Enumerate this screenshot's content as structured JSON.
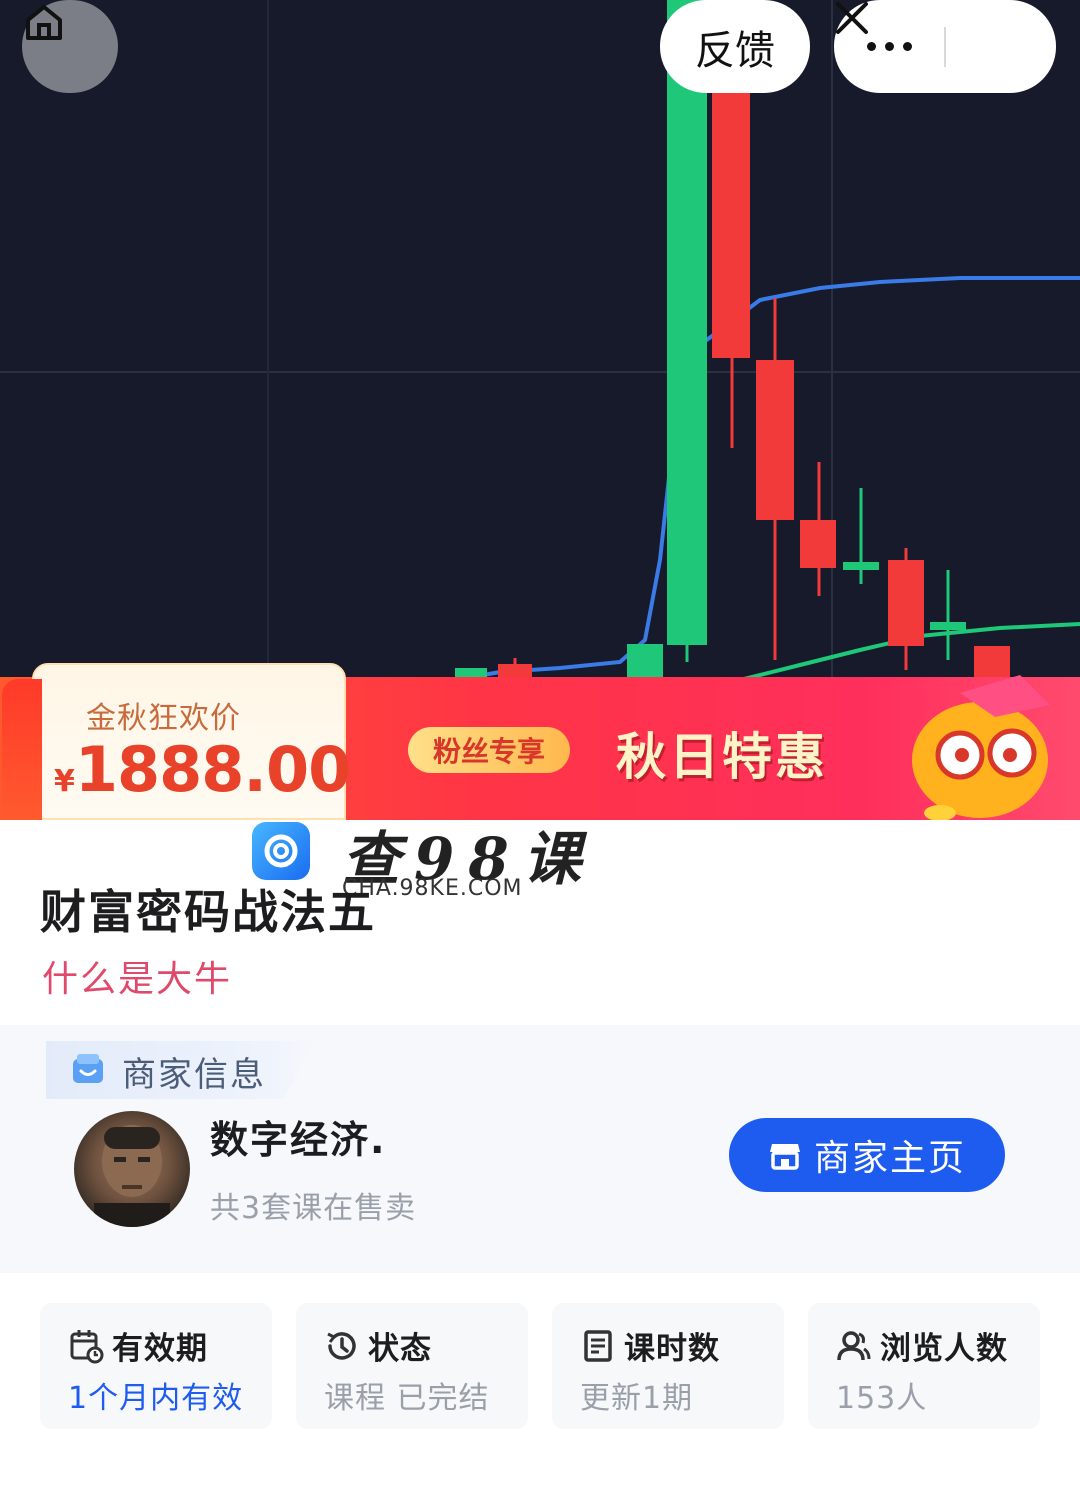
{
  "top_bar": {
    "feedback_label": "反馈"
  },
  "icons": {
    "home": "home-icon",
    "more": "more-dots-icon",
    "close": "close-icon",
    "store": "store-icon",
    "calendar": "calendar-icon",
    "status": "history-icon",
    "lessons": "document-icon",
    "viewers": "users-icon"
  },
  "promo": {
    "price_label": "金秋狂欢价",
    "currency": "¥",
    "price": "1888.00",
    "fans_tag": "粉丝专享",
    "slogan": "秋日特惠"
  },
  "watermark": {
    "brand": "查98课",
    "url": "CHA.98KE.COM"
  },
  "course": {
    "title": "财富密码战法五",
    "subtitle": "什么是大牛"
  },
  "merchant": {
    "section_label": "商家信息",
    "name": "数字经济.",
    "course_count": "共3套课在售卖",
    "home_button": "商家主页"
  },
  "stats": [
    {
      "label": "有效期",
      "value": "1个月内有效"
    },
    {
      "label": "状态",
      "value": "课程 已完结"
    },
    {
      "label": "课时数",
      "value": "更新1期"
    },
    {
      "label": "浏览人数",
      "value": "153人"
    }
  ],
  "colors": {
    "chart_bg": "#161a2a",
    "candle_up": "#1ec878",
    "candle_down": "#f23a3a",
    "ma_blue": "#3a7be8",
    "ma_green": "#1ec878",
    "primary": "#1e5cf0",
    "subtitle": "#e0496a"
  }
}
